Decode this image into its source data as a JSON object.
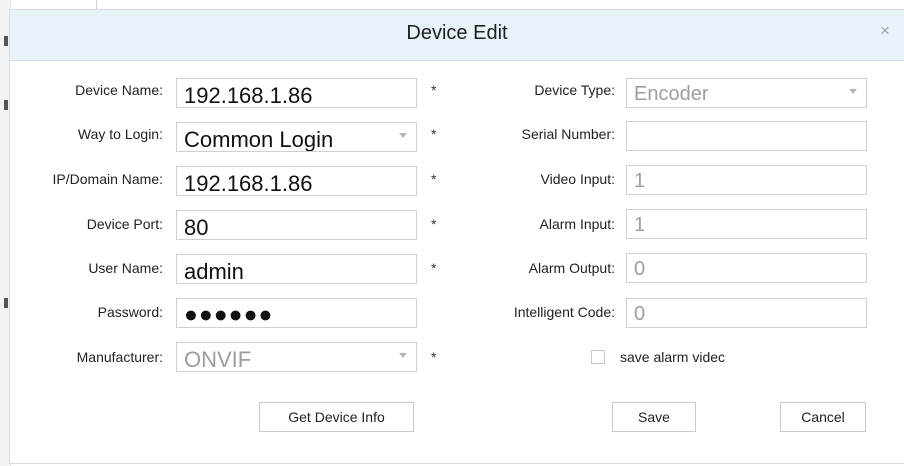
{
  "dialog": {
    "title": "Device Edit",
    "close_glyph": "×"
  },
  "left_fields": {
    "device_name": {
      "label": "Device Name:",
      "value": "192.168.1.86",
      "required": "*"
    },
    "way_to_login": {
      "label": "Way to Login:",
      "value": "Common Login",
      "required": "*"
    },
    "ip_domain": {
      "label": "IP/Domain Name:",
      "value": "192.168.1.86",
      "required": "*"
    },
    "device_port": {
      "label": "Device Port:",
      "value": "80",
      "required": "*"
    },
    "user_name": {
      "label": "User Name:",
      "value": "admin",
      "required": "*"
    },
    "password": {
      "label": "Password:",
      "value": "●●●●●●"
    },
    "manufacturer": {
      "label": "Manufacturer:",
      "value": "ONVIF",
      "required": "*"
    }
  },
  "right_fields": {
    "device_type": {
      "label": "Device Type:",
      "value": "Encoder"
    },
    "serial_number": {
      "label": "Serial Number:",
      "value": ""
    },
    "video_input": {
      "label": "Video Input:",
      "value": "1"
    },
    "alarm_input": {
      "label": "Alarm Input:",
      "value": "1"
    },
    "alarm_output": {
      "label": "Alarm Output:",
      "value": "0"
    },
    "intelligent_code": {
      "label": "Intelligent Code:",
      "value": "0"
    }
  },
  "save_alarm_video": {
    "label": "save alarm videc",
    "checked": false
  },
  "buttons": {
    "get_device_info": "Get Device Info",
    "save": "Save",
    "cancel": "Cancel"
  }
}
